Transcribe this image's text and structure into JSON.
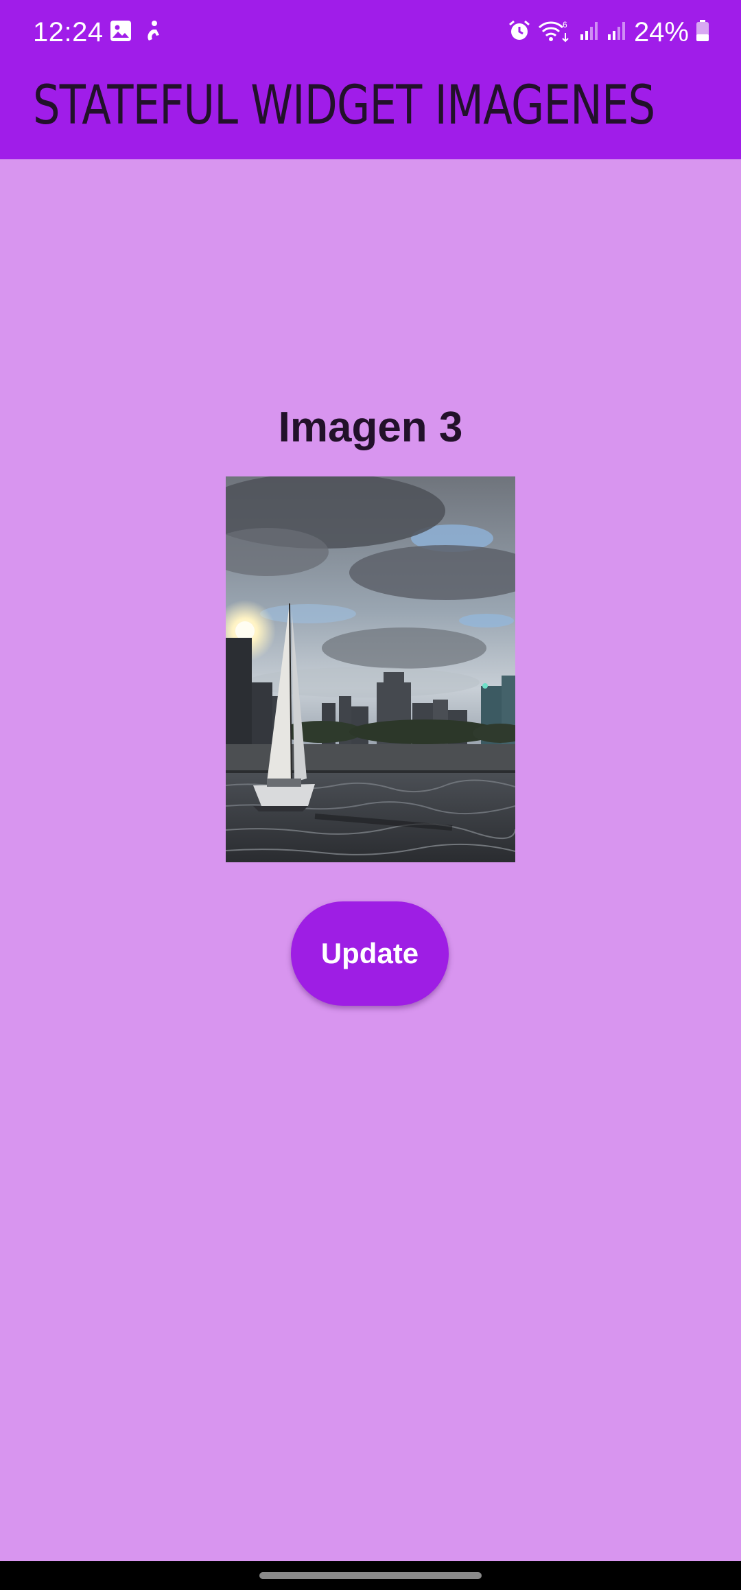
{
  "status_bar": {
    "time": "12:24",
    "battery_percent": "24%",
    "left_icons": [
      "gallery-icon",
      "accessibility-icon"
    ],
    "right_icons": [
      "alarm-icon",
      "wifi-6-icon",
      "signal-icon",
      "signal-icon",
      "battery-icon"
    ]
  },
  "app_bar": {
    "title": "STATEFUL WIDGET IMAGENES",
    "color": "#a01de9"
  },
  "main": {
    "image_caption": "Imagen 3",
    "image_subject": "sailboat-city-skyline-photo",
    "button_label": "Update",
    "background_color": "#d895ef",
    "button_color": "#9e1ee4"
  }
}
